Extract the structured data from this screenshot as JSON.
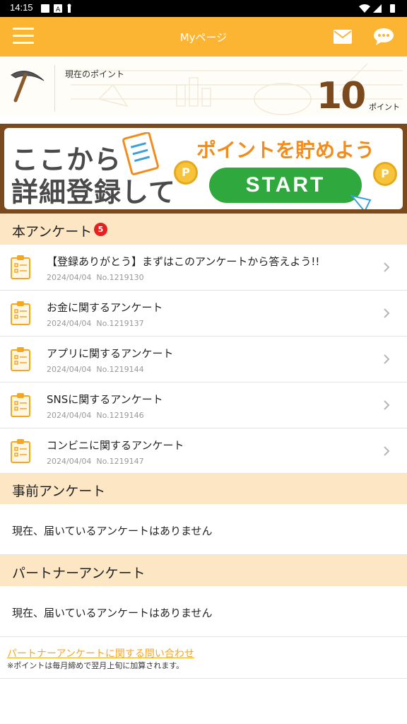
{
  "status_bar": {
    "time": "14:15"
  },
  "app_bar": {
    "title": "Myページ"
  },
  "points": {
    "label": "現在のポイント",
    "value": "10",
    "unit": "ポイント"
  },
  "banner": {
    "line1": "ここから",
    "line2": "詳細登録して",
    "headline": "ポイントを貯めよう",
    "start_label": "START",
    "coin_label": "P"
  },
  "main_surveys": {
    "title": "本アンケート",
    "badge_count": "5",
    "items": [
      {
        "title": "【登録ありがとう】まずはこのアンケートから答えよう!!",
        "date": "2024/04/04",
        "number": "No.1219130"
      },
      {
        "title": "お金に関するアンケート",
        "date": "2024/04/04",
        "number": "No.1219137"
      },
      {
        "title": "アプリに関するアンケート",
        "date": "2024/04/04",
        "number": "No.1219144"
      },
      {
        "title": "SNSに関するアンケート",
        "date": "2024/04/04",
        "number": "No.1219146"
      },
      {
        "title": "コンビニに関するアンケート",
        "date": "2024/04/04",
        "number": "No.1219147"
      }
    ]
  },
  "pre_surveys": {
    "title": "事前アンケート",
    "empty_text": "現在、届いているアンケートはありません"
  },
  "partner_surveys": {
    "title": "パートナーアンケート",
    "empty_text": "現在、届いているアンケートはありません"
  },
  "footer": {
    "link": "パートナーアンケートに関する問い合わせ",
    "note": "※ポイントは毎月締めで翌月上旬に加算されます。"
  },
  "colors": {
    "accent": "#fbb533",
    "section_bg": "#fde6c4",
    "badge": "#e81f1f",
    "start_green": "#2fa83e",
    "brown": "#7a4a1e"
  }
}
